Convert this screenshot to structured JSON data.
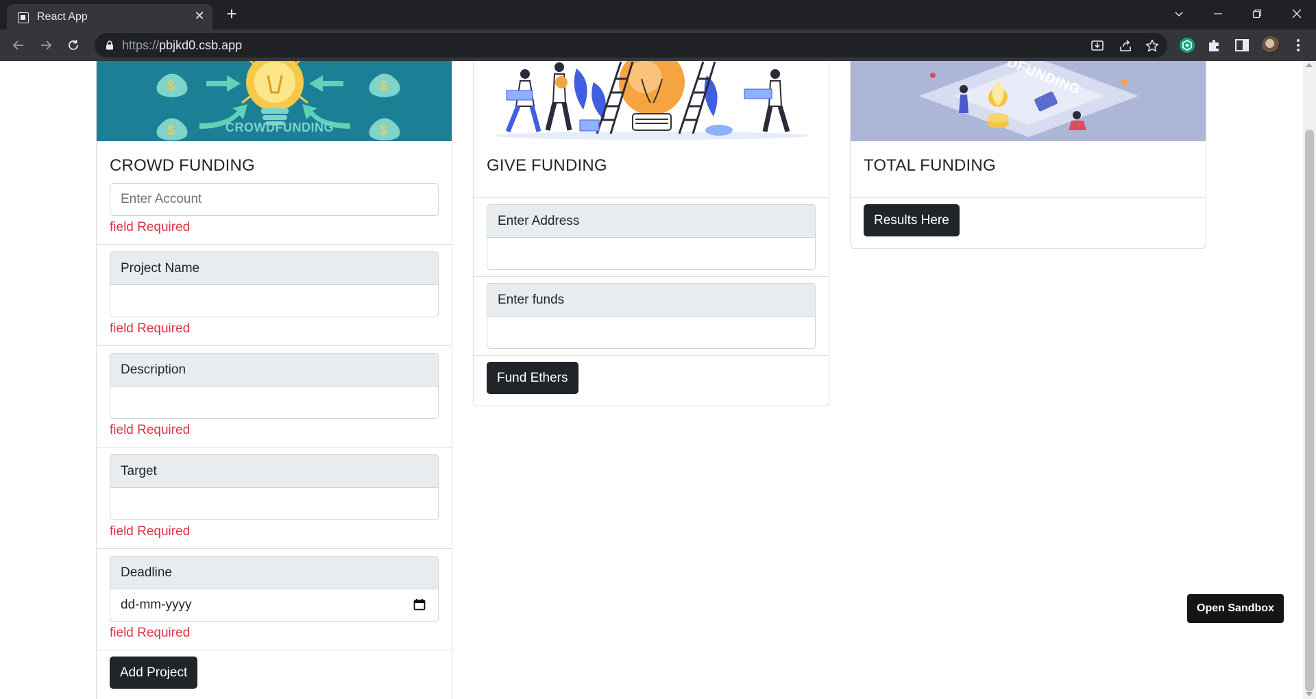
{
  "browser": {
    "tab_title": "React App",
    "url_scheme": "https://",
    "url_host": "pbjkd0.csb.app"
  },
  "cards": {
    "crowd": {
      "title": "CROWD FUNDING",
      "image_caption": "CROWDFUNDING",
      "account_placeholder": "Enter Account",
      "account_error": "field Required",
      "fields": [
        {
          "label": "Project Name",
          "value": "",
          "error": "field Required"
        },
        {
          "label": "Description",
          "value": "",
          "error": "field Required"
        },
        {
          "label": "Target",
          "value": "",
          "error": "field Required"
        },
        {
          "label": "Deadline",
          "value": "dd-mm-yyyy",
          "error": "field Required"
        }
      ],
      "submit_label": "Add Project"
    },
    "give": {
      "title": "GIVE FUNDING",
      "fields": [
        {
          "label": "Enter Address",
          "value": ""
        },
        {
          "label": "Enter funds",
          "value": ""
        }
      ],
      "submit_label": "Fund Ethers"
    },
    "total": {
      "title": "TOTAL FUNDING",
      "results_label": "Results Here",
      "image_caption": "DFUNDING"
    }
  },
  "sandbox_button": "Open Sandbox",
  "colors": {
    "error": "#dc3545",
    "button_dark": "#212529",
    "input_group_bg": "#e9ecef",
    "crowd_image_bg": "#1b8095",
    "total_image_bg": "#aeb6d8"
  }
}
